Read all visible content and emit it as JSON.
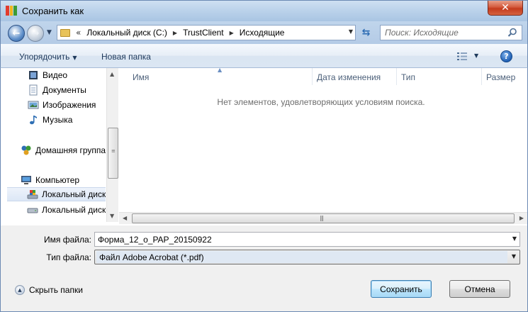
{
  "window": {
    "title": "Сохранить как",
    "close_glyph": "✕"
  },
  "address": {
    "overflow_glyph": "«",
    "crumbs": [
      "Локальный диск (C:)",
      "TrustClient",
      "Исходящие"
    ]
  },
  "search": {
    "placeholder": "Поиск: Исходящие"
  },
  "toolbar": {
    "organize_label": "Упорядочить",
    "new_folder_label": "Новая папка"
  },
  "nav": {
    "items": [
      {
        "label": "Видео",
        "icon": "video-library-icon"
      },
      {
        "label": "Документы",
        "icon": "documents-library-icon"
      },
      {
        "label": "Изображения",
        "icon": "pictures-library-icon"
      },
      {
        "label": "Музыка",
        "icon": "music-library-icon"
      },
      {
        "label": "Домашняя группа",
        "icon": "homegroup-icon"
      },
      {
        "label": "Компьютер",
        "icon": "computer-icon"
      },
      {
        "label": "Локальный диск",
        "icon": "system-drive-icon",
        "selected": true
      },
      {
        "label": "Локальный диск",
        "icon": "drive-icon"
      }
    ]
  },
  "file_list": {
    "columns": [
      "Имя",
      "Дата изменения",
      "Тип",
      "Размер"
    ],
    "empty_message": "Нет элементов, удовлетворяющих условиям поиска."
  },
  "form": {
    "filename_label": "Имя файла:",
    "filename_value": "Форма_12_о_PAP_20150922",
    "filetype_label": "Тип файла:",
    "filetype_value": "Файл Adobe Acrobat (*.pdf)"
  },
  "footer": {
    "hide_folders_label": "Скрыть папки",
    "save_label": "Сохранить",
    "cancel_label": "Отмена"
  },
  "colors": {
    "accent": "#3c7fb1",
    "titlebar": "#bcd3eb",
    "close": "#c43b1d"
  }
}
